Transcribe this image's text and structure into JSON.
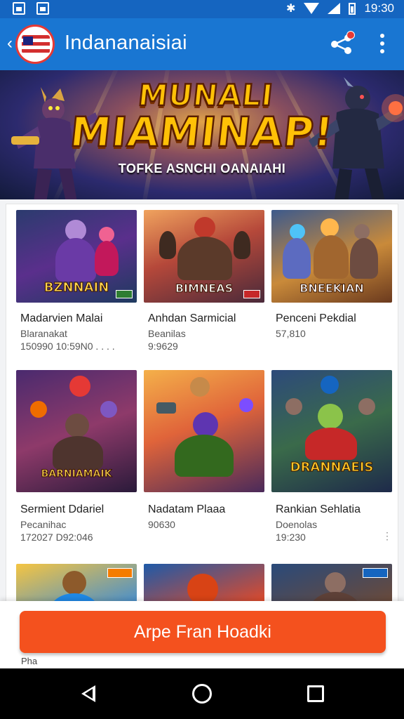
{
  "status_bar": {
    "time": "19:30"
  },
  "app_bar": {
    "title": "Indananaisiai"
  },
  "banner": {
    "title_line1": "MUNALI",
    "title_line2": "MIAMINAP!",
    "subtitle": "TOFKE ASNCHI OANAIAHI"
  },
  "cards": [
    {
      "logo": "BZNNAIN",
      "title": "Madarvien Malai",
      "subtitle": "Blaranakat",
      "meta": "150990  10:59N0  . . . ."
    },
    {
      "logo": "BIMNEAS",
      "title": "Anhdan Sarmicial",
      "subtitle": "Beanilas",
      "meta": "9:9629"
    },
    {
      "logo": "BNEEKIAN",
      "title": "Penceni Pekdial",
      "subtitle": "",
      "meta": "57,810"
    },
    {
      "logo": "BARNIAMAIK",
      "title": "Sermient Ddariel",
      "subtitle": "Pecanihac",
      "meta": "172027  D92:046"
    },
    {
      "logo": "",
      "title": "Nadatam Plaaa",
      "subtitle": "",
      "meta": "90630"
    },
    {
      "logo": "DRANNAEIS",
      "title": "Rankian Sehlatia",
      "subtitle": "Doenolas",
      "meta": "19:230"
    }
  ],
  "cta": {
    "label": "Arpe Fran Hoadki"
  },
  "peek": {
    "text": "Pha"
  },
  "colors": {
    "app_bar": "#1976d2",
    "status_bar": "#1565c0",
    "cta": "#f4511e"
  },
  "icons": [
    "back-arrow-icon",
    "share-icon",
    "more-vert-icon",
    "wifi-icon",
    "signal-icon",
    "battery-icon",
    "nav-back-icon",
    "nav-home-icon",
    "nav-recent-icon"
  ]
}
